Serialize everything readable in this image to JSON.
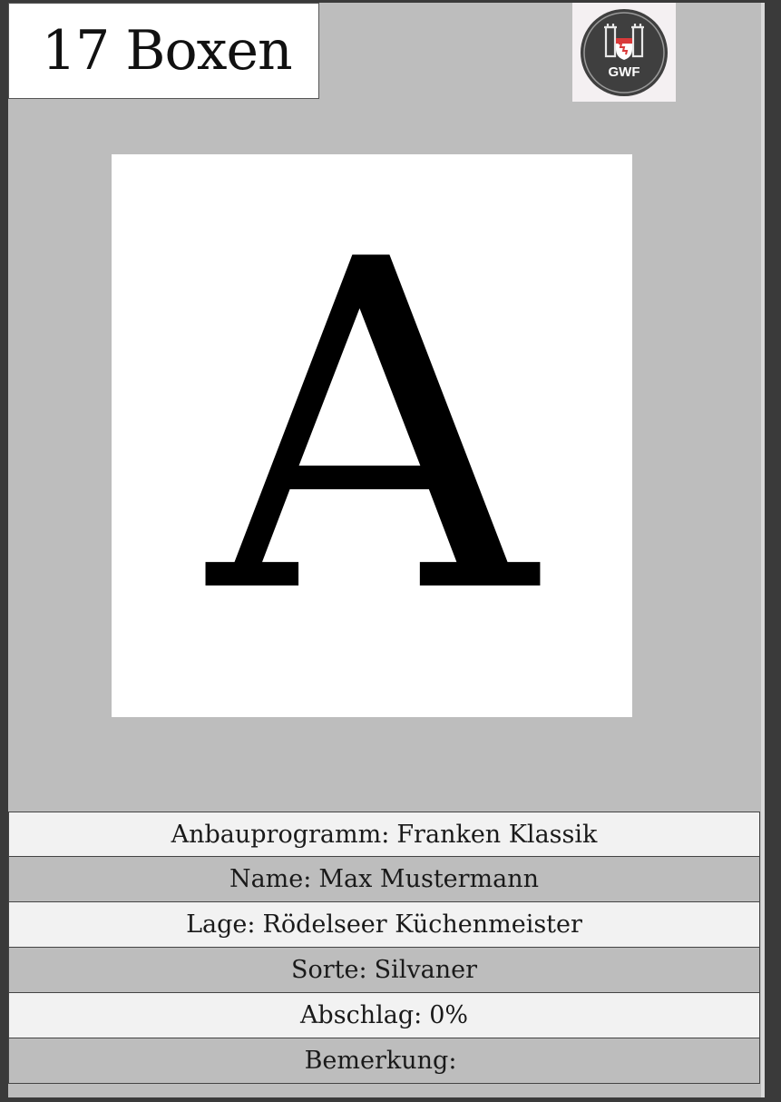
{
  "card": {
    "count_label": "17 Boxen",
    "logo": {
      "icon": "gwf-coat-of-arms-icon",
      "text": "GWF",
      "colors": {
        "badge": "#3f3f3f",
        "ring": "#9a9a9a",
        "accent": "#d93a3a"
      }
    },
    "big_letter": "A"
  },
  "info": {
    "rows": [
      {
        "label": "Anbauprogramm",
        "value": "Franken Klassik"
      },
      {
        "label": "Name",
        "value": "Max Mustermann"
      },
      {
        "label": "Lage",
        "value": "Rödelseer Küchenmeister"
      },
      {
        "label": "Sorte",
        "value": "Silvaner"
      },
      {
        "label": "Abschlag",
        "value": "0%"
      },
      {
        "label": "Bemerkung",
        "value": ""
      }
    ]
  },
  "colors": {
    "card_background": "#bdbdbd",
    "row_light": "#f2f2f2",
    "row_dark": "#bdbdbd"
  }
}
